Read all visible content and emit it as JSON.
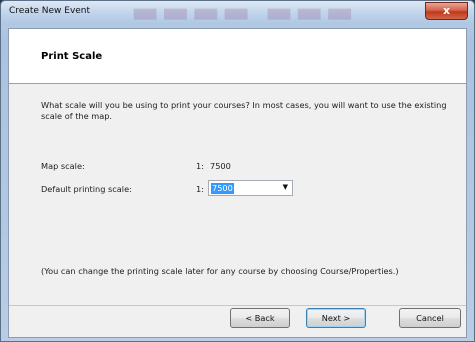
{
  "window": {
    "title": "Create New Event",
    "close_glyph": "x"
  },
  "header": {
    "title": "Print Scale"
  },
  "intro_text": "What scale will you be using to print your courses? In most cases, you will want to use the existing scale of the map.",
  "map_scale": {
    "label": "Map scale:",
    "prefix": "1:",
    "value": "7500"
  },
  "print_scale": {
    "label": "Default printing scale:",
    "prefix": "1:",
    "value": "7500"
  },
  "note": "(You can change the printing scale later for any course by choosing Course/Properties.)",
  "buttons": {
    "back": "< Back",
    "next": "Next >",
    "cancel": "Cancel"
  },
  "icons": {
    "close": "close-icon",
    "dropdown": "chevron-down-icon"
  }
}
